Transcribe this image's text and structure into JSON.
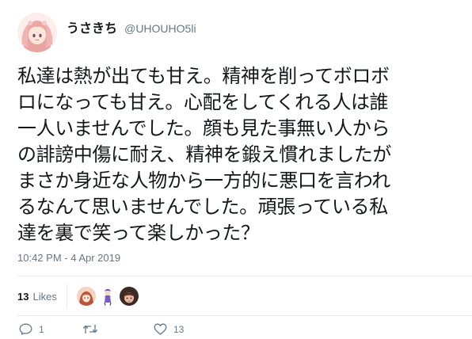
{
  "user": {
    "display_name": "うさきち",
    "handle": "@UHOUHO5li"
  },
  "tweet": {
    "lines": [
      "私達は熱が出ても甘え。精神を削ってボロボ",
      "ロになっても甘え。心配をしてくれる人は誰",
      "一人いませんでした。顔も見た事無い人から",
      "の誹謗中傷に耐え、精神を鍛え慣れましたが",
      "まさか身近な人物から一方的に悪口を言われ",
      "るなんて思いませんでした。頑張っている私",
      "達を裏で笑って楽しかった？"
    ],
    "timestamp": "10:42 PM - 4 Apr 2019"
  },
  "stats": {
    "likes_count": "13",
    "likes_label": "Likes"
  },
  "actions": {
    "reply_count": "1",
    "retweet_count": "",
    "like_count": "13"
  },
  "colors": {
    "text": "#14171a",
    "secondary": "#657786",
    "divider": "#e6ecf0"
  },
  "icons": {
    "reply": "reply-icon",
    "retweet": "retweet-icon",
    "like": "heart-icon"
  }
}
